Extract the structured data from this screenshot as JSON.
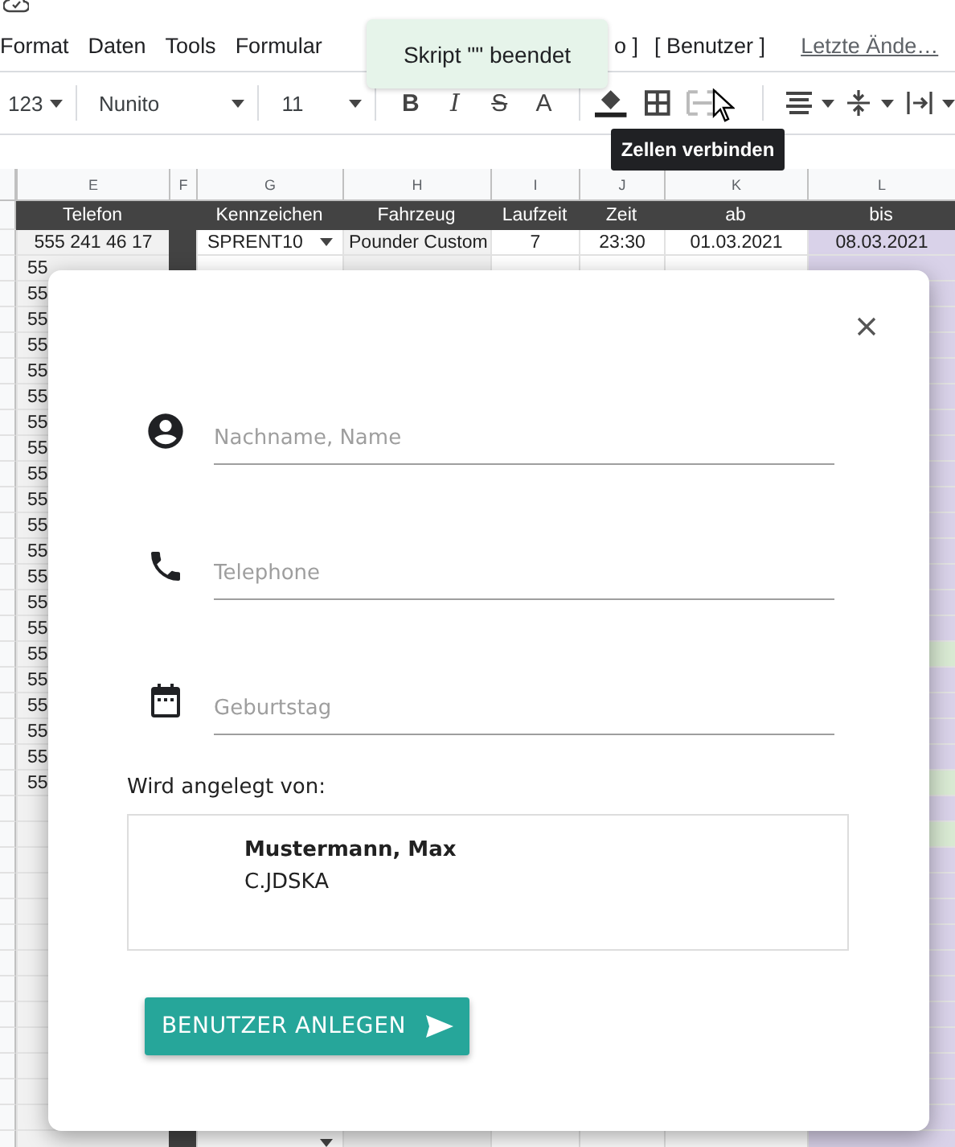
{
  "menu": [
    {
      "label": "Format"
    },
    {
      "label": "Daten"
    },
    {
      "label": "Tools"
    },
    {
      "label": "Formular"
    },
    {
      "label": "o ]"
    },
    {
      "label": "[ Benutzer ]"
    }
  ],
  "last_edit": "Letzte Ände…",
  "toast": "Skript \"\" beendet",
  "toolbar": {
    "number_format": "123",
    "font": "Nunito",
    "font_size": "11",
    "format_buttons": [
      "B",
      "I",
      "S",
      "A"
    ]
  },
  "tooltip": "Zellen verbinden",
  "columns": [
    {
      "letter": "E",
      "title": "Telefon"
    },
    {
      "letter": "F"
    },
    {
      "letter": "G",
      "title": "Kennzeichen"
    },
    {
      "letter": "H",
      "title": "Fahrzeug"
    },
    {
      "letter": "I",
      "title": "Laufzeit"
    },
    {
      "letter": "J",
      "title": "Zeit"
    },
    {
      "letter": "K",
      "title": "ab"
    },
    {
      "letter": "L",
      "title": "bis"
    }
  ],
  "first_row": {
    "telefon": "555 241 46 17",
    "kennzeichen": "SPRENT10",
    "fahrzeug": "Pounder Custom",
    "laufzeit": "7",
    "zeit": "23:30",
    "ab": "01.03.2021",
    "bis": "08.03.2021"
  },
  "rows": [
    {
      "telefon": "55",
      "color": "#d9d2e9"
    },
    {
      "telefon": "55",
      "color": "#d9d2e9"
    },
    {
      "telefon": "55",
      "color": "#d9d2e9"
    },
    {
      "telefon": "55",
      "color": "#d9d2e9"
    },
    {
      "telefon": "55",
      "color": "#d9d2e9"
    },
    {
      "telefon": "55",
      "color": "#d9d2e9"
    },
    {
      "telefon": "55",
      "color": "#d9d2e9"
    },
    {
      "telefon": "55",
      "color": "#d9d2e9"
    },
    {
      "telefon": "55",
      "color": "#d9d2e9"
    },
    {
      "telefon": "55",
      "color": "#d9d2e9"
    },
    {
      "telefon": "55",
      "color": "#d9d2e9"
    },
    {
      "telefon": "55",
      "color": "#d9d2e9"
    },
    {
      "telefon": "55",
      "color": "#d9d2e9"
    },
    {
      "telefon": "55",
      "color": "#d9d2e9"
    },
    {
      "telefon": "55",
      "color": "#d9d2e9"
    },
    {
      "telefon": "55",
      "color": "#d9ead3"
    },
    {
      "telefon": "55",
      "color": "#d9d2e9"
    },
    {
      "telefon": "55",
      "color": "#d9d2e9"
    },
    {
      "telefon": "55",
      "color": "#d9d2e9"
    },
    {
      "telefon": "55",
      "color": "#d9d2e9"
    },
    {
      "telefon": "55",
      "color": "#d9ead3"
    },
    {
      "color": "#d9d2e9"
    },
    {
      "color": "#d9ead3"
    },
    {
      "color": "#d9d2e9"
    },
    {
      "color": "#d9d2e9"
    },
    {
      "color": "#d9d2e9"
    },
    {
      "color": "#d9d2e9"
    },
    {
      "color": "#d9d2e9"
    },
    {
      "color": "#d9d2e9"
    },
    {
      "color": "#d9d2e9"
    },
    {
      "color": "#d9d2e9"
    },
    {
      "color": "#d9d2e9"
    },
    {
      "color": "#d9d2e9"
    },
    {
      "color": "#d9d2e9"
    }
  ],
  "dialog": {
    "fields": [
      {
        "kind": "person",
        "placeholder": "Nachname, Name"
      },
      {
        "kind": "phone",
        "placeholder": "Telephone"
      },
      {
        "kind": "calendar",
        "placeholder": "Geburtstag"
      }
    ],
    "creator_label": "Wird angelegt von:",
    "creator": {
      "name": "Mustermann, Max",
      "id": "C.JDSKA"
    },
    "submit": "BENUTZER ANLEGEN"
  }
}
